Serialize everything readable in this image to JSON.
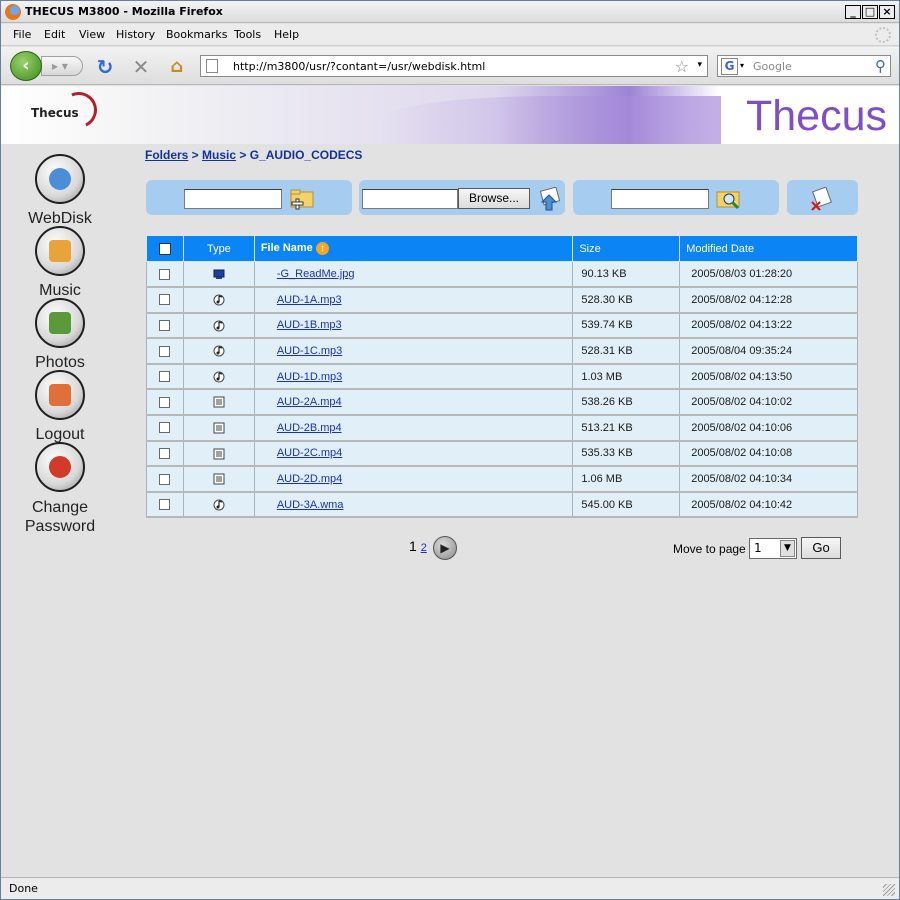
{
  "window": {
    "title": "THECUS M3800 - Mozilla Firefox"
  },
  "menu": [
    "File",
    "Edit",
    "View",
    "History",
    "Bookmarks",
    "Tools",
    "Help"
  ],
  "address": {
    "url": "http://m3800/usr/?contant=/usr/webdisk.html"
  },
  "search": {
    "placeholder": "Google"
  },
  "banner": {
    "logo_small": "Thecus",
    "logo_big": "Thecus"
  },
  "sidebar": {
    "items": [
      {
        "label": "WebDisk",
        "icon": "webdisk-icon"
      },
      {
        "label": "Music",
        "icon": "music-icon"
      },
      {
        "label": "Photos",
        "icon": "photos-icon"
      },
      {
        "label": "Logout",
        "icon": "logout-icon"
      },
      {
        "label": "Change Password",
        "icon": "change-password-icon"
      }
    ]
  },
  "breadcrumb": {
    "root": "Folders",
    "sep1": " > ",
    "folder": "Music",
    "sep2": " > ",
    "current": "G_AUDIO_CODECS"
  },
  "toolbar": {
    "browse_label": "Browse..."
  },
  "table": {
    "headers": {
      "type": "Type",
      "name": "File Name",
      "size": "Size",
      "date": "Modified Date"
    },
    "rows": [
      {
        "name": "-G_ReadMe.jpg",
        "size": "90.13 KB",
        "date": "2005/08/03 01:28:20",
        "type": "image"
      },
      {
        "name": "AUD-1A.mp3",
        "size": "528.30 KB",
        "date": "2005/08/02 04:12:28",
        "type": "audio"
      },
      {
        "name": "AUD-1B.mp3",
        "size": "539.74 KB",
        "date": "2005/08/02 04:13:22",
        "type": "audio"
      },
      {
        "name": "AUD-1C.mp3",
        "size": "528.31 KB",
        "date": "2005/08/04 09:35:24",
        "type": "audio"
      },
      {
        "name": "AUD-1D.mp3",
        "size": "1.03 MB",
        "date": "2005/08/02 04:13:50",
        "type": "audio"
      },
      {
        "name": "AUD-2A.mp4",
        "size": "538.26 KB",
        "date": "2005/08/02 04:10:02",
        "type": "video"
      },
      {
        "name": "AUD-2B.mp4",
        "size": "513.21 KB",
        "date": "2005/08/02 04:10:06",
        "type": "video"
      },
      {
        "name": "AUD-2C.mp4",
        "size": "535.33 KB",
        "date": "2005/08/02 04:10:08",
        "type": "video"
      },
      {
        "name": "AUD-2D.mp4",
        "size": "1.06 MB",
        "date": "2005/08/02 04:10:34",
        "type": "video"
      },
      {
        "name": "AUD-3A.wma",
        "size": "545.00 KB",
        "date": "2005/08/02 04:10:42",
        "type": "audio"
      }
    ]
  },
  "pager": {
    "current": "1",
    "next_page": "2",
    "move_label": "Move to page",
    "selected_page": "1",
    "go_label": "Go"
  },
  "status": {
    "text": "Done"
  },
  "colors": {
    "header_blue": "#0b84f5",
    "row_bg": "#e1f0f8",
    "panel_blue": "#a6cdef",
    "brand_purple": "#7f4fc9"
  }
}
